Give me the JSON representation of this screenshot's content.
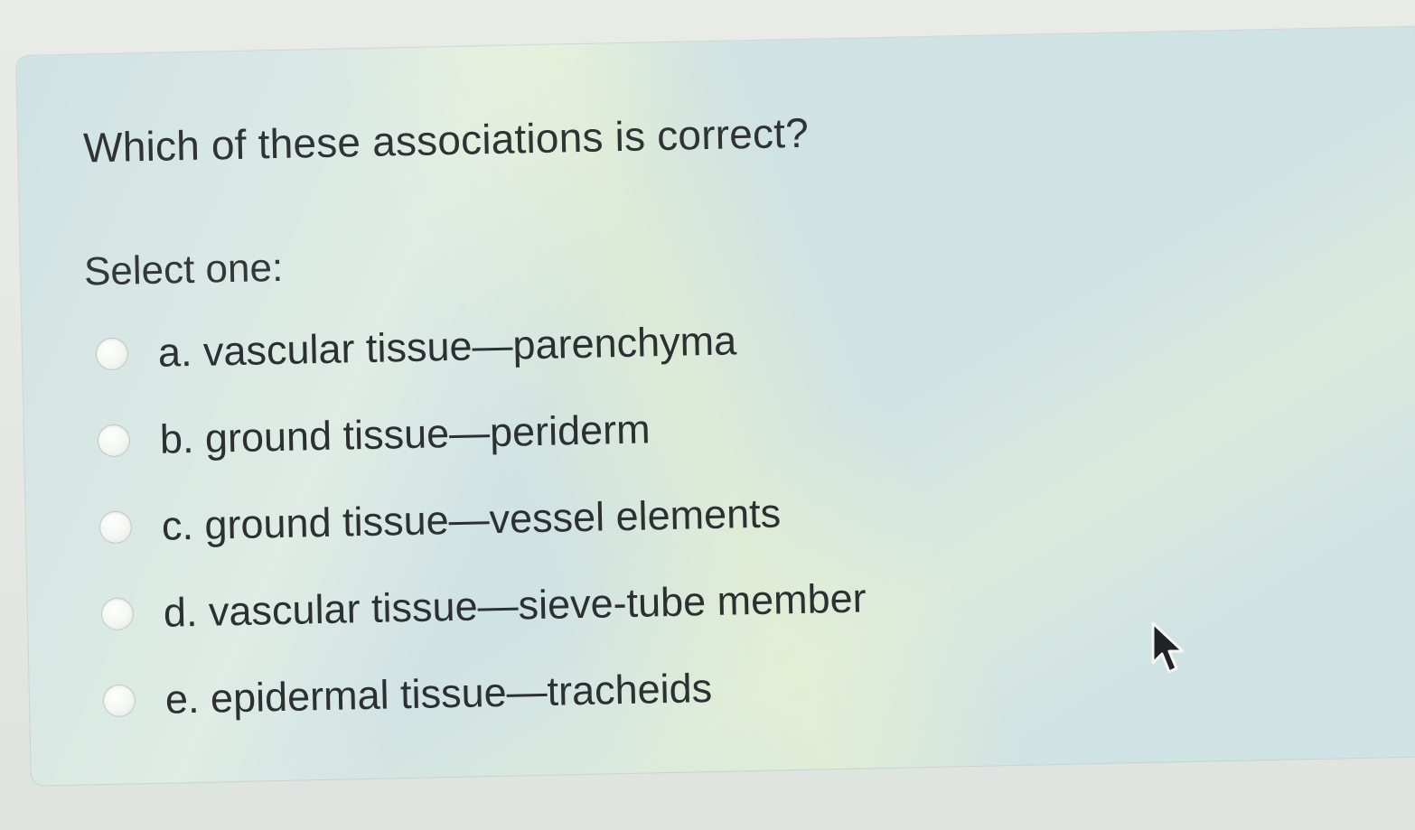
{
  "question": {
    "text": "Which of these associations is correct?",
    "select_label": "Select one:",
    "options": [
      {
        "label": "a. vascular tissue—parenchyma"
      },
      {
        "label": "b. ground tissue—periderm"
      },
      {
        "label": "c. ground tissue—vessel elements"
      },
      {
        "label": "d. vascular tissue—sieve-tube member"
      },
      {
        "label": "e. epidermal tissue—tracheids"
      }
    ]
  },
  "cursor": {
    "icon": "arrow-pointer-icon"
  },
  "colors": {
    "card_background": "#cfe2e4",
    "text": "#2f3336",
    "radio": "#f3f6f1"
  }
}
